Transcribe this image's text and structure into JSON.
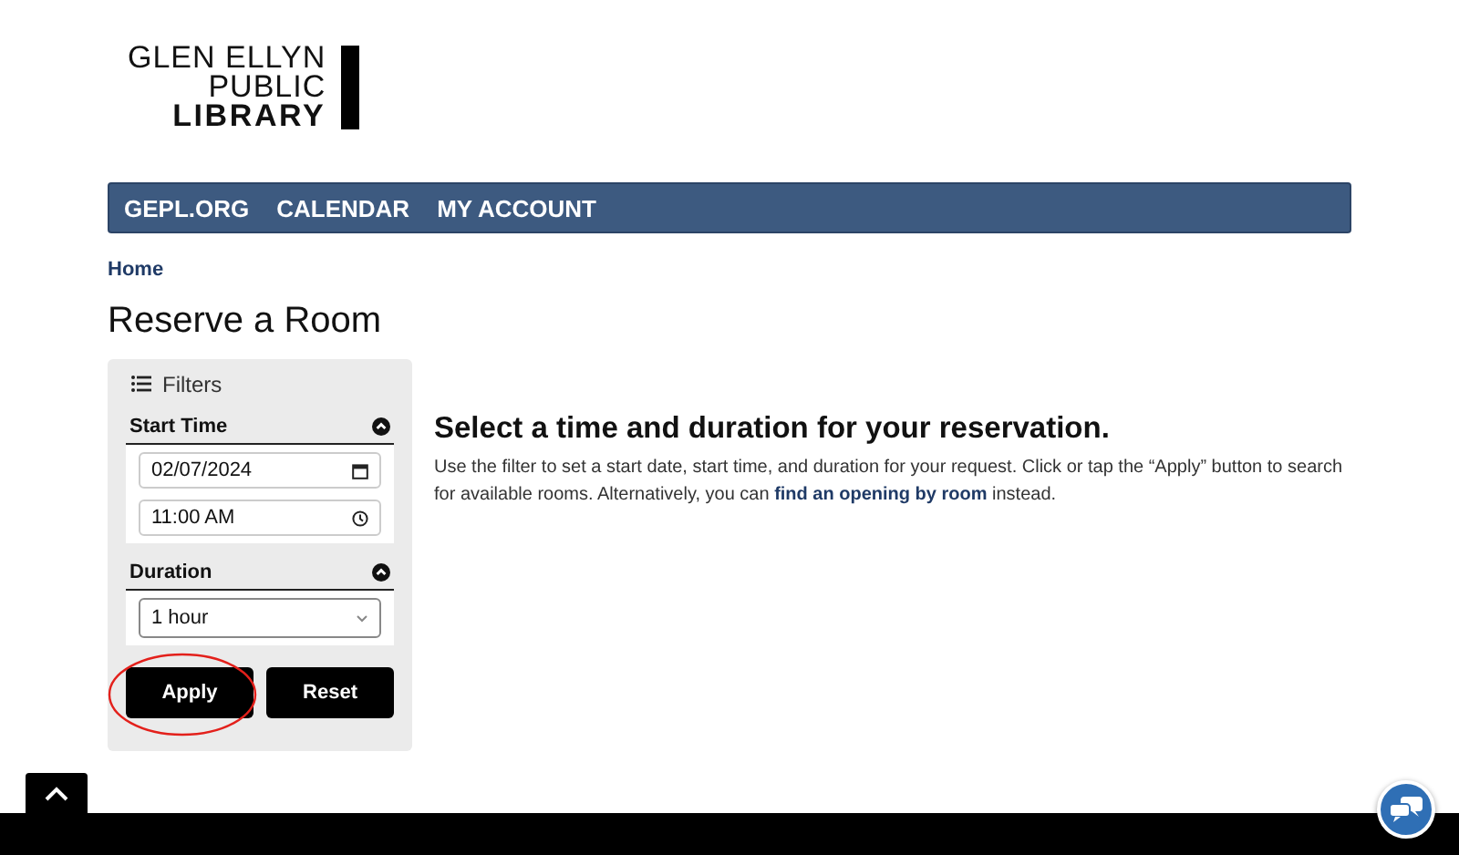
{
  "logo": {
    "lines": [
      "GLEN ELLYN",
      "PUBLIC",
      "LIBRARY"
    ]
  },
  "nav": {
    "items": [
      "GEPL.ORG",
      "CALENDAR",
      "MY ACCOUNT"
    ]
  },
  "breadcrumb": "Home",
  "page_title": "Reserve a Room",
  "filters": {
    "title": "Filters",
    "sections": [
      {
        "kind": "datetime",
        "title": "Start Time",
        "expanded": true,
        "date": "02/07/2024",
        "time": "11:00 AM"
      },
      {
        "kind": "select",
        "title": "Duration",
        "expanded": true,
        "value": "1 hour"
      }
    ],
    "buttons": [
      "Apply",
      "Reset"
    ]
  },
  "main": {
    "heading": "Select a time and duration for your reservation.",
    "text_before": "Use the filter to set a start date, start time, and duration for your request. Click or tap the “Apply” button to search for available rooms. Alternatively, you can",
    "link": "find an opening by room",
    "text_after": "instead."
  }
}
